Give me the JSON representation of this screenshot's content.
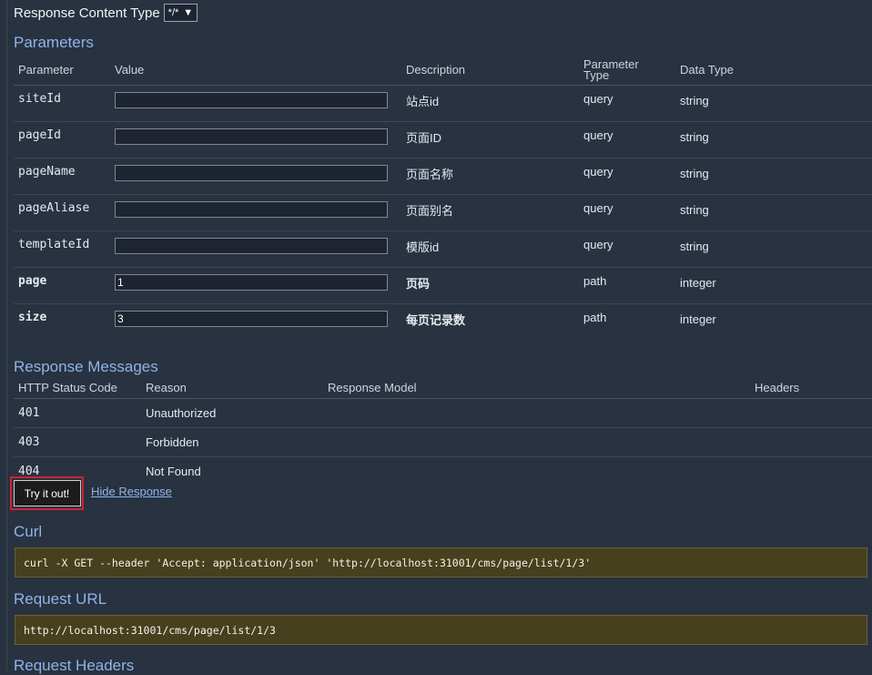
{
  "response_content_type": {
    "label": "Response Content Type",
    "value": "*/*"
  },
  "parameters": {
    "title": "Parameters",
    "headers": {
      "parameter": "Parameter",
      "value": "Value",
      "description": "Description",
      "param_type_line1": "Parameter",
      "param_type_line2": "Type",
      "data_type": "Data Type"
    },
    "rows": [
      {
        "name": "siteId",
        "value": "",
        "description": "站点id",
        "param_type": "query",
        "data_type": "string"
      },
      {
        "name": "pageId",
        "value": "",
        "description": "页面ID",
        "param_type": "query",
        "data_type": "string"
      },
      {
        "name": "pageName",
        "value": "",
        "description": "页面名称",
        "param_type": "query",
        "data_type": "string"
      },
      {
        "name": "pageAliase",
        "value": "",
        "description": "页面别名",
        "param_type": "query",
        "data_type": "string"
      },
      {
        "name": "templateId",
        "value": "",
        "description": "模版id",
        "param_type": "query",
        "data_type": "string"
      },
      {
        "name": "page",
        "value": "1",
        "description": "页码",
        "param_type": "path",
        "data_type": "integer"
      },
      {
        "name": "size",
        "value": "3",
        "description": "每页记录数",
        "param_type": "path",
        "data_type": "integer"
      }
    ]
  },
  "response_messages": {
    "title": "Response Messages",
    "headers": {
      "status": "HTTP Status Code",
      "reason": "Reason",
      "model": "Response Model",
      "headers": "Headers"
    },
    "rows": [
      {
        "status": "401",
        "reason": "Unauthorized"
      },
      {
        "status": "403",
        "reason": "Forbidden"
      },
      {
        "status": "404",
        "reason": "Not Found"
      }
    ]
  },
  "actions": {
    "try_label": "Try it out!",
    "hide_label": "Hide Response"
  },
  "curl": {
    "title": "Curl",
    "command": "curl -X GET --header 'Accept: application/json' 'http://localhost:31001/cms/page/list/1/3'"
  },
  "request_url": {
    "title": "Request URL",
    "value": "http://localhost:31001/cms/page/list/1/3"
  },
  "request_headers": {
    "title": "Request Headers"
  }
}
